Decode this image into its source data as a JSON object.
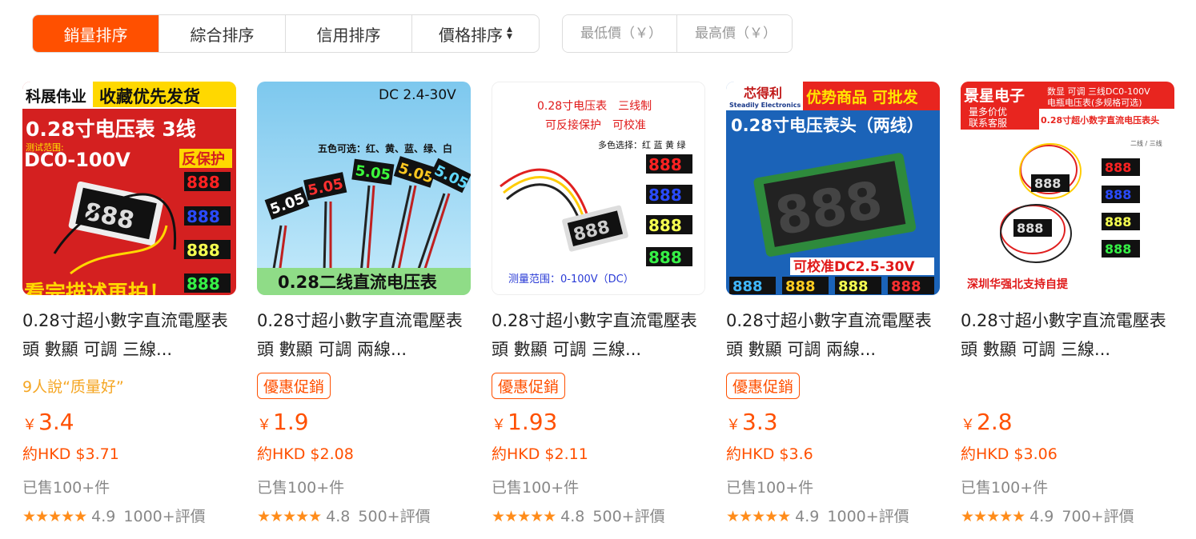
{
  "sort": {
    "tabs": [
      "銷量排序",
      "綜合排序",
      "信用排序",
      "價格排序"
    ]
  },
  "price_filter": {
    "min_placeholder": "最低價（￥）",
    "max_placeholder": "最高價（￥）"
  },
  "colors": {
    "accent": "#ff5000",
    "review": "#f5a623",
    "star": "#ff8c1a"
  },
  "products": [
    {
      "image_text": [
        "科展伟业",
        "收藏优先发货",
        "0.28寸电压表 3线",
        "测试范围:",
        "DC0-100V",
        "反保护",
        "看完描述再拍！"
      ],
      "title": "0.28寸超小數字直流電壓表頭 數顯 可調 三線...",
      "tag": "9人說“质量好”",
      "tag_type": "review",
      "price": "3.4",
      "currency": "￥",
      "hkd": "約HKD $3.71",
      "sold": "已售100+件",
      "rating": "4.9",
      "reviews": "1000+評價"
    },
    {
      "image_text": [
        "DC 2.4-30V",
        "五色可选：红、黄、蓝、绿、白",
        "0.28二线直流电压表"
      ],
      "title": "0.28寸超小數字直流電壓表頭 數顯 可調 兩線...",
      "tag": "優惠促銷",
      "tag_type": "promo",
      "price": "1.9",
      "currency": "￥",
      "hkd": "約HKD $2.08",
      "sold": "已售100+件",
      "rating": "4.8",
      "reviews": "500+評價"
    },
    {
      "image_text": [
        "0.28寸电压表　三线制",
        "可反接保护　可校准",
        "多色选择：红 蓝 黄 绿",
        "测量范围：0-100V（DC）"
      ],
      "title": "0.28寸超小數字直流電壓表頭 數顯 可調 三線...",
      "tag": "優惠促銷",
      "tag_type": "promo",
      "price": "1.93",
      "currency": "￥",
      "hkd": "約HKD $2.11",
      "sold": "已售100+件",
      "rating": "4.8",
      "reviews": "500+評價"
    },
    {
      "image_text": [
        "芯得利",
        "Steadily Electronics",
        "优势商品 可批发",
        "0.28寸电压表头（两线）",
        "可校准DC2.5-30V"
      ],
      "title": "0.28寸超小數字直流電壓表頭 數顯 可調 兩線...",
      "tag": "優惠促銷",
      "tag_type": "promo",
      "price": "3.3",
      "currency": "￥",
      "hkd": "約HKD $3.6",
      "sold": "已售100+件",
      "rating": "4.9",
      "reviews": "1000+評價"
    },
    {
      "image_text": [
        "景星电子",
        "量多价优",
        "联系客服",
        "数显 可调 三线DC0-100V",
        "电瓶电压表(多规格可选)",
        "0.28寸超小数字直流电压表头",
        "二线 / 三线",
        "深圳华强北支持自提"
      ],
      "title": "0.28寸超小數字直流電壓表頭 數顯 可調 三線...",
      "tag": "",
      "tag_type": "none",
      "price": "2.8",
      "currency": "￥",
      "hkd": "約HKD $3.06",
      "sold": "已售100+件",
      "rating": "4.9",
      "reviews": "700+評價"
    }
  ]
}
